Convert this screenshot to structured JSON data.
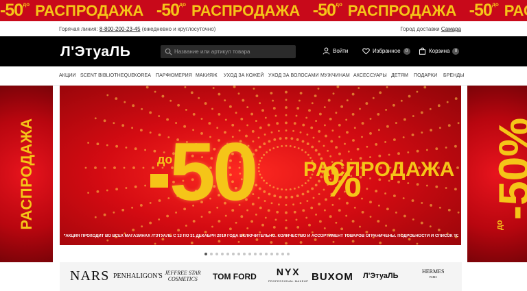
{
  "promo_strip": {
    "items": [
      {
        "pct": "-50",
        "prefix": "до",
        "word": "РАСПРОДАЖА"
      },
      {
        "pct": "-50",
        "prefix": "до",
        "word": "РАСПРОДАЖА"
      },
      {
        "pct": "-50",
        "prefix": "до",
        "word": "РАСПРОДАЖА"
      },
      {
        "pct": "-50",
        "prefix": "до",
        "word": "РАСПРОДАЖА"
      }
    ],
    "colors": {
      "bg": "#c8091a",
      "accent": "#f5c518"
    }
  },
  "info_bar": {
    "hotline_label": "Горячая линия:",
    "hotline_phone": "8-800-200-23-45",
    "hotline_hours": "(ежедневно и круглосуточно)",
    "city_label": "Город доставки",
    "city_name": "Самара"
  },
  "header": {
    "logo": "Л'ЭтуаЛЬ",
    "search_placeholder": "Название или артикул товара",
    "login_label": "Войти",
    "favorites_label": "Избранное",
    "favorites_count": "0",
    "cart_label": "Корзина",
    "cart_count": "0"
  },
  "nav": {
    "items": [
      "АКЦИИ",
      "SCENT BIBLIOTHEQUE",
      "KOREA",
      "ПАРФЮМЕРИЯ",
      "МАКИЯЖ",
      "УХОД ЗА КОЖЕЙ",
      "УХОД ЗА ВОЛОСАМИ",
      "МУЖЧИНАМ",
      "АКСЕССУАРЫ",
      "ДЕТЯМ",
      "ПОДАРКИ",
      "БРЕНДЫ"
    ]
  },
  "side_banners": {
    "left_text": "РАСПРОДАЖА",
    "right_pct": "-50",
    "right_prefix": "до",
    "right_pct_sign": "%"
  },
  "hero": {
    "prefix": "до",
    "pct": "50",
    "pct_sign": "%",
    "title": "РАСПРОДАЖА",
    "note": "*АКЦИЯ ПРОХОДИТ ВО ВСЕХ МАГАЗИНАХ Л'ЭТУАЛЬ С 13 ПО 31 ДЕКАБРЯ 2019 ГОДА ВКЛЮЧИТЕЛЬНО. КОЛИЧЕСТВО И АССОРТИМЕНТ ТОВАРОВ ОГРАНИЧЕНЫ. ПОДРОБНОСТИ И СПИСОК ТОВАРОВ, УЧАСТВУЮЩИХ В АКЦИИ, НА WWW.LETU.RU"
  },
  "carousel": {
    "slide_count": 16,
    "active_index": 0
  },
  "brands": {
    "nars": "NARS",
    "penhaligons": "PENHALIGON'S",
    "jeffree_line1": "JEFFREE STAR",
    "jeffree_line2": "COSMETICS",
    "tomford": "TOM FORD",
    "nyx": "NYX",
    "nyx_sub": "PROFESSIONAL MAKEUP",
    "buxom": "BUXOM",
    "letu": "Л'ЭтуаЛЬ",
    "hermes": "HERMES",
    "hermes_sub": "PARIS"
  }
}
